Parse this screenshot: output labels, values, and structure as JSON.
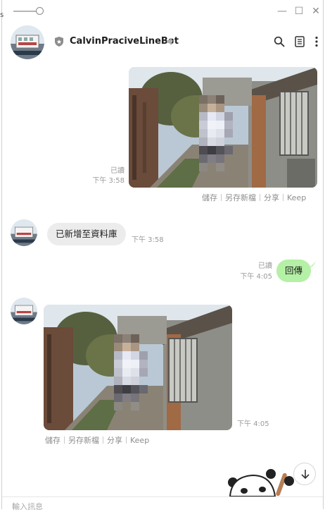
{
  "window": {
    "minimize_glyph": "—",
    "maximize_glyph": "☐",
    "close_glyph": "✕",
    "left_edge_char": "s"
  },
  "header": {
    "chat_name": "CalvinPraciveLineBot",
    "badge_icon": "shield-icon",
    "mute_icon": "speaker-mute-icon",
    "search_icon": "search-icon",
    "notes_icon": "notes-icon",
    "menu_icon": "more-vertical-icon"
  },
  "messages": [
    {
      "side": "out",
      "type": "image",
      "read": "已讀",
      "time": "下午 3:58",
      "actions": [
        "儲存",
        "另存新檔",
        "分享",
        "Keep"
      ]
    },
    {
      "side": "in",
      "type": "text",
      "text": "已新增至資料庫",
      "time": "下午 3:58"
    },
    {
      "side": "out",
      "type": "text",
      "text": "回傳",
      "read": "已讀",
      "time": "下午 4:05"
    },
    {
      "side": "in",
      "type": "image",
      "time": "下午 4:05",
      "actions": [
        "儲存",
        "另存新檔",
        "分享",
        "Keep"
      ]
    }
  ],
  "footer": {
    "input_placeholder": "輸入訊息",
    "scroll_icon": "arrow-down-icon"
  },
  "colors": {
    "outgoing_bubble": "#b4f0a5",
    "incoming_bubble": "#ececec"
  }
}
